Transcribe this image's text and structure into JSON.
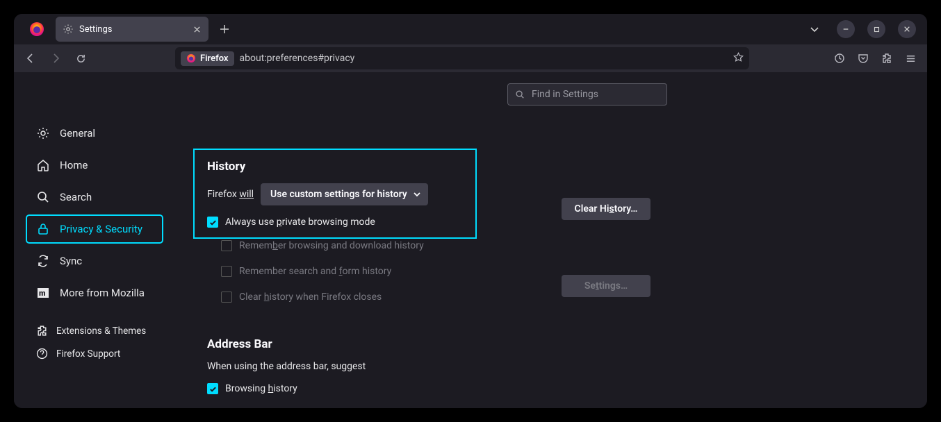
{
  "titlebar": {
    "tab_title": "Settings",
    "firefox_label": "Firefox",
    "url": "about:preferences#privacy"
  },
  "search": {
    "placeholder": "Find in Settings"
  },
  "sidebar": {
    "items": [
      {
        "label": "General"
      },
      {
        "label": "Home"
      },
      {
        "label": "Search"
      },
      {
        "label": "Privacy & Security"
      },
      {
        "label": "Sync"
      },
      {
        "label": "More from Mozilla"
      }
    ],
    "secondary": [
      {
        "label": "Extensions & Themes"
      },
      {
        "label": "Firefox Support"
      }
    ]
  },
  "history": {
    "title": "History",
    "prefix": "Firefox ",
    "will": "will",
    "dropdown": "Use custom settings for history",
    "chk_private_pre": "Always use ",
    "chk_private_u": "p",
    "chk_private_post": "rivate browsing mode",
    "chk_remember_pre": "Remem",
    "chk_remember_u": "b",
    "chk_remember_post": "er browsing and download history",
    "chk_search_pre": "Remember search and ",
    "chk_search_u": "f",
    "chk_search_post": "orm history",
    "chk_clear_pre": "Clear ",
    "chk_clear_u": "h",
    "chk_clear_post": "istory when Firefox closes",
    "clear_btn_pre": "Clear Hi",
    "clear_btn_u": "s",
    "clear_btn_post": "tory…",
    "settings_btn_pre": "Se",
    "settings_btn_u": "t",
    "settings_btn_post": "tings…"
  },
  "address": {
    "title": "Address Bar",
    "sub": "When using the address bar, suggest",
    "chk_browsing_pre": "Browsing ",
    "chk_browsing_u": "h",
    "chk_browsing_post": "istory"
  }
}
